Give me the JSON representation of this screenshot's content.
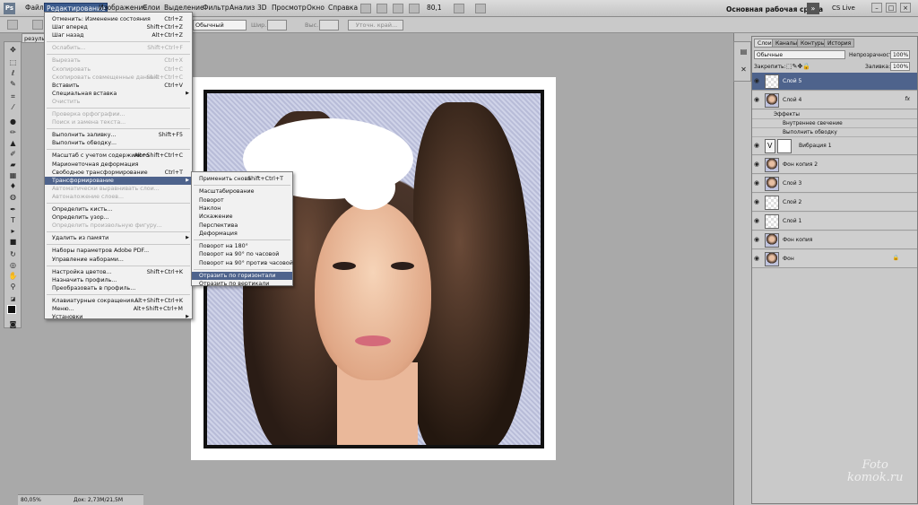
{
  "app": {
    "logo": "Ps",
    "workspace": "Основная рабочая среда",
    "cslive": "CS Live",
    "zoom_field": "80,1"
  },
  "menubar": [
    "Файл",
    "Редактирование",
    "Изображение",
    "Слои",
    "Выделение",
    "Фильтр",
    "Анализ",
    "3D",
    "Просмотр",
    "Окно",
    "Справка"
  ],
  "options": {
    "style_value": "Обычный",
    "width_label": "Шир.:",
    "height_label": "Выс.:",
    "refine_label": "Уточн. край..."
  },
  "doc_tab": "резуль",
  "status": {
    "zoom": "80,05%",
    "doc": "Док: 2,73M/21,5M"
  },
  "edit_menu": [
    {
      "label": "Отменить: Изменение состояния",
      "sc": "Ctrl+Z"
    },
    {
      "label": "Шаг вперед",
      "sc": "Shift+Ctrl+Z"
    },
    {
      "label": "Шаг назад",
      "sc": "Alt+Ctrl+Z"
    },
    {
      "sep": true
    },
    {
      "label": "Ослабить...",
      "sc": "Shift+Ctrl+F",
      "dis": true
    },
    {
      "sep": true
    },
    {
      "label": "Вырезать",
      "sc": "Ctrl+X",
      "dis": true
    },
    {
      "label": "Скопировать",
      "sc": "Ctrl+C",
      "dis": true
    },
    {
      "label": "Скопировать совмещенные данные",
      "sc": "Shift+Ctrl+C",
      "dis": true
    },
    {
      "label": "Вставить",
      "sc": "Ctrl+V"
    },
    {
      "label": "Специальная вставка",
      "arrow": true
    },
    {
      "label": "Очистить",
      "dis": true
    },
    {
      "sep": true
    },
    {
      "label": "Проверка орфографии...",
      "dis": true
    },
    {
      "label": "Поиск и замена текста...",
      "dis": true
    },
    {
      "sep": true
    },
    {
      "label": "Выполнить заливку...",
      "sc": "Shift+F5"
    },
    {
      "label": "Выполнить обводку..."
    },
    {
      "sep": true
    },
    {
      "label": "Масштаб с учетом содержимого",
      "sc": "Alt+Shift+Ctrl+C"
    },
    {
      "label": "Марионеточная деформация"
    },
    {
      "label": "Свободное трансформирование",
      "sc": "Ctrl+T"
    },
    {
      "label": "Трансформирование",
      "arrow": true,
      "hl": true
    },
    {
      "label": "Автоматически выравнивать слои...",
      "dis": true
    },
    {
      "label": "Автоналожение слоев...",
      "dis": true
    },
    {
      "sep": true
    },
    {
      "label": "Определить кисть..."
    },
    {
      "label": "Определить узор..."
    },
    {
      "label": "Определить произвольную фигуру...",
      "dis": true
    },
    {
      "sep": true
    },
    {
      "label": "Удалить из памяти",
      "arrow": true
    },
    {
      "sep": true
    },
    {
      "label": "Наборы параметров Adobe PDF..."
    },
    {
      "label": "Управление наборами..."
    },
    {
      "sep": true
    },
    {
      "label": "Настройка цветов...",
      "sc": "Shift+Ctrl+K"
    },
    {
      "label": "Назначить профиль..."
    },
    {
      "label": "Преобразовать в профиль..."
    },
    {
      "sep": true
    },
    {
      "label": "Клавиатурные сокращения...",
      "sc": "Alt+Shift+Ctrl+K"
    },
    {
      "label": "Меню...",
      "sc": "Alt+Shift+Ctrl+M"
    },
    {
      "label": "Установки",
      "arrow": true
    }
  ],
  "transform_menu": [
    {
      "label": "Применить снова",
      "sc": "Shift+Ctrl+T"
    },
    {
      "sep": true
    },
    {
      "label": "Масштабирование"
    },
    {
      "label": "Поворот"
    },
    {
      "label": "Наклон"
    },
    {
      "label": "Искажение"
    },
    {
      "label": "Перспектива"
    },
    {
      "label": "Деформация"
    },
    {
      "sep": true
    },
    {
      "label": "Поворот на 180°"
    },
    {
      "label": "Поворот на 90° по часовой"
    },
    {
      "label": "Поворот на 90° против часовой"
    },
    {
      "sep": true
    },
    {
      "label": "Отразить по горизонтали",
      "hl": true
    },
    {
      "label": "Отразить по вертикали"
    }
  ],
  "layers_panel": {
    "tabs": [
      "Слои",
      "Каналы",
      "Контуры",
      "История"
    ],
    "blend": "Обычные",
    "opacity_label": "Непрозрачность:",
    "opacity": "100%",
    "lock_label": "Закрепить:",
    "fill_label": "Заливка:",
    "fill": "100%",
    "layers": [
      {
        "name": "Слой 5",
        "selected": true,
        "thumb": "t"
      },
      {
        "name": "Слой 4",
        "thumb": "p",
        "fx": "fx"
      },
      {
        "sub": "Эффекты"
      },
      {
        "sub": "Внутреннее свечение"
      },
      {
        "sub": "Выполнить обводку"
      },
      {
        "name": "Вибрация 1",
        "thumb": "adj"
      },
      {
        "name": "Фон копия 2",
        "thumb": "p"
      },
      {
        "name": "Слой 3",
        "thumb": "p"
      },
      {
        "name": "Слой 2",
        "thumb": "t"
      },
      {
        "name": "Слой 1",
        "thumb": "t"
      },
      {
        "name": "Фон копия",
        "thumb": "p"
      },
      {
        "name": "Фон",
        "thumb": "p",
        "lock": true
      }
    ]
  },
  "watermark": [
    "Foto",
    "komok.ru"
  ]
}
